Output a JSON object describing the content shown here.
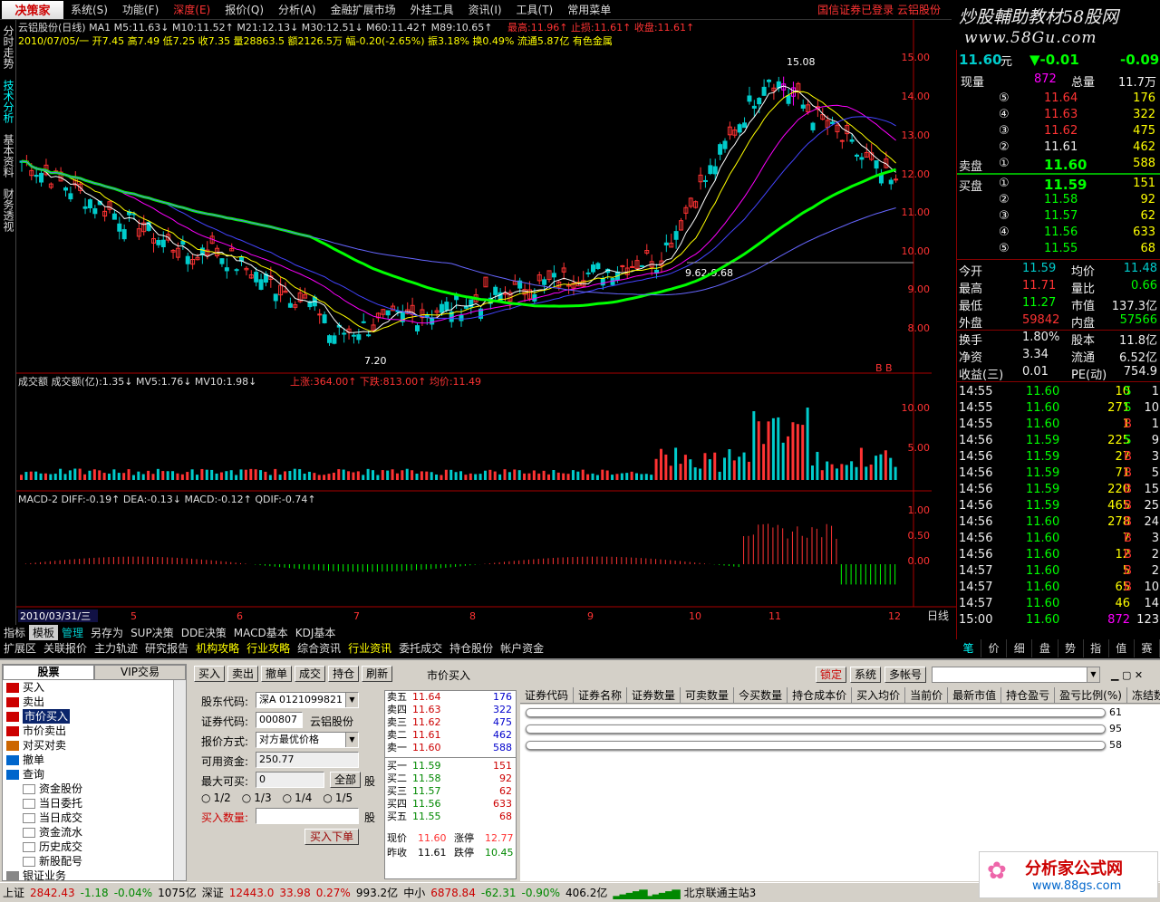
{
  "menu": {
    "logo": "决策家",
    "items": [
      "系统(S)",
      "功能(F)",
      "深度(E)",
      "报价(Q)",
      "分析(A)",
      "金融扩展市场",
      "外挂工具",
      "资讯(I)",
      "工具(T)",
      "常用菜单"
    ],
    "status": "国信证券已登录  云铝股份"
  },
  "ad": {
    "line1": "炒股輔助教材58股网",
    "line2": "www.58Gu.com"
  },
  "left_tabs": [
    "分时走势",
    "技术分析",
    "基本资料",
    "财务透视"
  ],
  "chart": {
    "title_line": "云铝股份(日线) MA1  M5:11.63↓  M10:11.52↑  M21:12.13↓  M30:12.51↓  M60:11.42↑  M89:10.65↑",
    "title_line_b": "最高:11.96↑  止损:11.61↑  收盘:11.61↑",
    "info_line": "2010/07/05/一 开7.45 高7.49 低7.25 收7.35 量28863.5 额2126.5万 幅-0.20(-2.65%) 振3.18% 换0.49% 流通5.87亿 有色金属",
    "price_ticks": [
      "15.00",
      "14.00",
      "13.00",
      "12.00",
      "11.00",
      "10.00",
      "9.00",
      "8.00"
    ],
    "high_label": "15.08",
    "low_label": "7.20",
    "mid_label": "9.62-9.68",
    "vol_title": "成交额  成交额(亿):1.35↓  MV5:1.76↓  MV10:1.98↓",
    "vol_title_b": "上涨:364.00↑  下跌:813.00↑  均价:11.49",
    "vol_ticks": [
      "10.00",
      "5.00"
    ],
    "macd_title": "MACD-2  DIFF:-0.19↑  DEA:-0.13↓  MACD:-0.12↑  QDIF:-0.74↑",
    "macd_ticks": [
      "1.00",
      "0.50",
      "0.00"
    ],
    "date_label": "2010/03/31/三",
    "month_labels": [
      "5",
      "6",
      "7",
      "8",
      "9",
      "10",
      "11",
      "12"
    ],
    "period": "日线",
    "bb_label": "B B"
  },
  "quote": {
    "price": "11.60",
    "unit": "元",
    "change": "▼-0.01",
    "change_pct": "-0.09",
    "xianliang_label": "现量",
    "xianliang": "872",
    "zongliang_label": "总量",
    "zongliang": "11.7万",
    "sell": [
      {
        "lvl": "⑤",
        "price": "11.64",
        "vol": "176"
      },
      {
        "lvl": "④",
        "price": "11.63",
        "vol": "322"
      },
      {
        "lvl": "③",
        "price": "11.62",
        "vol": "475"
      },
      {
        "lvl": "②",
        "price": "11.61",
        "vol": "462"
      },
      {
        "lvl": "①",
        "price": "11.60",
        "vol": "588"
      }
    ],
    "buy": [
      {
        "lvl": "①",
        "price": "11.59",
        "vol": "151"
      },
      {
        "lvl": "②",
        "price": "11.58",
        "vol": "92"
      },
      {
        "lvl": "③",
        "price": "11.57",
        "vol": "62"
      },
      {
        "lvl": "④",
        "price": "11.56",
        "vol": "633"
      },
      {
        "lvl": "⑤",
        "price": "11.55",
        "vol": "68"
      }
    ],
    "sell_label": "卖盘",
    "buy_label": "买盘",
    "stats": [
      {
        "l1": "今开",
        "v1": "11.59",
        "l2": "均价",
        "v2": "11.48"
      },
      {
        "l1": "最高",
        "v1": "11.71",
        "l2": "量比",
        "v2": "0.66"
      },
      {
        "l1": "最低",
        "v1": "11.27",
        "l2": "市值",
        "v2": "137.3亿"
      },
      {
        "l1": "外盘",
        "v1": "59842",
        "l2": "内盘",
        "v2": "57566"
      },
      {
        "l1": "换手",
        "v1": "1.80%",
        "l2": "股本",
        "v2": "11.8亿"
      },
      {
        "l1": "净资",
        "v1": "3.34",
        "l2": "流通",
        "v2": "6.52亿"
      },
      {
        "l1": "收益(三)",
        "v1": "0.01",
        "l2": "PE(动)",
        "v2": "754.9"
      }
    ],
    "ticks": [
      {
        "t": "14:55",
        "p": "11.60",
        "v": "10",
        "d": "S",
        "n": "1"
      },
      {
        "t": "14:55",
        "p": "11.60",
        "v": "271",
        "d": "S",
        "n": "10"
      },
      {
        "t": "14:55",
        "p": "11.60",
        "v": "1",
        "d": "B",
        "n": "1"
      },
      {
        "t": "14:56",
        "p": "11.59",
        "v": "225",
        "d": "S",
        "n": "9"
      },
      {
        "t": "14:56",
        "p": "11.59",
        "v": "27",
        "d": "B",
        "n": "3"
      },
      {
        "t": "14:56",
        "p": "11.59",
        "v": "71",
        "d": "B",
        "n": "5"
      },
      {
        "t": "14:56",
        "p": "11.59",
        "v": "220",
        "d": "B",
        "n": "15"
      },
      {
        "t": "14:56",
        "p": "11.59",
        "v": "465",
        "d": "B",
        "n": "25"
      },
      {
        "t": "14:56",
        "p": "11.60",
        "v": "278",
        "d": "B",
        "n": "24"
      },
      {
        "t": "14:56",
        "p": "11.60",
        "v": "7",
        "d": "B",
        "n": "3"
      },
      {
        "t": "14:56",
        "p": "11.60",
        "v": "12",
        "d": "B",
        "n": "2"
      },
      {
        "t": "14:57",
        "p": "11.60",
        "v": "5",
        "d": "B",
        "n": "2"
      },
      {
        "t": "14:57",
        "p": "11.60",
        "v": "65",
        "d": "B",
        "n": "10"
      },
      {
        "t": "14:57",
        "p": "11.60",
        "v": "46",
        "d": "",
        "n": "14"
      },
      {
        "t": "15:00",
        "p": "11.60",
        "v": "872",
        "d": "",
        "n": "123"
      }
    ],
    "panel_tabs": [
      "笔",
      "价",
      "细",
      "盘",
      "势",
      "指",
      "值",
      "赛"
    ]
  },
  "bottom_strip": {
    "row1": [
      "指标",
      "模板",
      "管理",
      "另存为",
      "SUP决策",
      "DDE决策",
      "MACD基本",
      "KDJ基本"
    ],
    "row2": [
      "扩展区",
      "关联报价",
      "主力轨迹",
      "研究报告",
      "机构攻略",
      "行业攻略",
      "综合资讯",
      "行业资讯",
      "委托成交",
      "持仓股份",
      "帐户资金"
    ]
  },
  "trade": {
    "tree_tabs": [
      "股票",
      "VIP交易"
    ],
    "tree": [
      {
        "label": "买入",
        "icon": "BUY",
        "sub": false
      },
      {
        "label": "卖出",
        "icon": "SELL",
        "sub": false
      },
      {
        "label": "市价买入",
        "icon": "BUY",
        "sub": false,
        "sel": true
      },
      {
        "label": "市价卖出",
        "icon": "SELL",
        "sub": false
      },
      {
        "label": "对买对卖",
        "icon": "BS",
        "sub": false
      },
      {
        "label": "撤单",
        "icon": "X",
        "sub": false
      },
      {
        "label": "查询",
        "icon": "Q",
        "sub": false
      },
      {
        "label": "资金股份",
        "icon": "",
        "sub": true
      },
      {
        "label": "当日委托",
        "icon": "",
        "sub": true
      },
      {
        "label": "当日成交",
        "icon": "",
        "sub": true
      },
      {
        "label": "资金流水",
        "icon": "",
        "sub": true
      },
      {
        "label": "历史成交",
        "icon": "",
        "sub": true
      },
      {
        "label": "新股配号",
        "icon": "",
        "sub": true
      },
      {
        "label": "银证业务",
        "icon": "",
        "sub": false
      }
    ],
    "toolbar": [
      "买入",
      "卖出",
      "撤单",
      "成交",
      "持仓",
      "刷新"
    ],
    "form_title": "市价买入",
    "gudong_label": "股东代码:",
    "gudong_value": "深A 0121099821",
    "code_label": "证券代码:",
    "code_value": "000807",
    "code_name": "云铝股份",
    "method_label": "报价方式:",
    "method_value": "对方最优价格",
    "funds_label": "可用资金:",
    "funds_value": "250.77",
    "max_label": "最大可买:",
    "max_value": "0",
    "all_btn": "全部",
    "gu": "股",
    "fractions": [
      "1/2",
      "1/3",
      "1/4",
      "1/5"
    ],
    "qty_label": "买入数量:",
    "qty_value": "",
    "submit": "买入下单",
    "book_sell": [
      {
        "l": "卖五",
        "p": "11.64",
        "v": "176"
      },
      {
        "l": "卖四",
        "p": "11.63",
        "v": "322"
      },
      {
        "l": "卖三",
        "p": "11.62",
        "v": "475"
      },
      {
        "l": "卖二",
        "p": "11.61",
        "v": "462"
      },
      {
        "l": "卖一",
        "p": "11.60",
        "v": "588"
      }
    ],
    "book_buy": [
      {
        "l": "买一",
        "p": "11.59",
        "v": "151"
      },
      {
        "l": "买二",
        "p": "11.58",
        "v": "92"
      },
      {
        "l": "买三",
        "p": "11.57",
        "v": "62"
      },
      {
        "l": "买四",
        "p": "11.56",
        "v": "633"
      },
      {
        "l": "买五",
        "p": "11.55",
        "v": "68"
      }
    ],
    "book_now_label": "现价",
    "book_now": "11.60",
    "zt_label": "涨停",
    "zt": "12.77",
    "book_prev_label": "昨收",
    "book_prev": "11.61",
    "dt_label": "跌停",
    "dt": "10.45",
    "grid_buttons": [
      "锁定",
      "系统",
      "多帐号"
    ],
    "grid_cols": [
      "证券代码",
      "证券名称",
      "证券数量",
      "可卖数量",
      "今买数量",
      "持仓成本价",
      "买入均价",
      "当前价",
      "最新市值",
      "持仓盈亏",
      "盈亏比例(%)",
      "冻结数"
    ],
    "grid_vals": [
      "61",
      "95",
      "58"
    ]
  },
  "status": {
    "sh_label": "上证",
    "sh": "2842.43",
    "sh_chg": "-1.18",
    "sh_pct": "-0.04%",
    "sh_amt": "1075亿",
    "sz_label": "深证",
    "sz": "12443.0",
    "sz_chg": "33.98",
    "sz_pct": "0.27%",
    "sz_amt": "993.2亿",
    "zx_label": "中小",
    "zx": "6878.84",
    "zx_chg": "-62.31",
    "zx_pct": "-0.90%",
    "zx_amt": "406.2亿",
    "server": "北京联通主站3"
  },
  "watermark": {
    "name": "分析家公式网",
    "url": "www.88gs.com"
  }
}
